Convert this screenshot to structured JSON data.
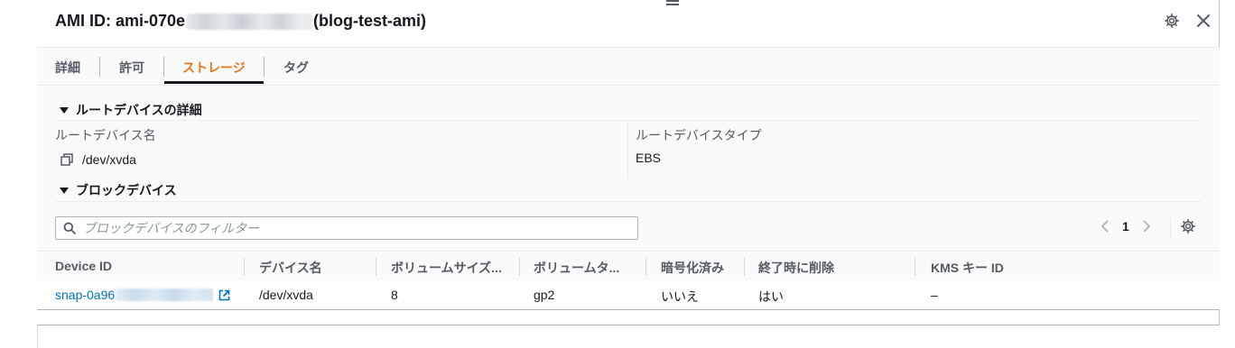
{
  "panel": {
    "title_prefix": "AMI ID: ami-070e",
    "title_suffix": "(blog-test-ami)"
  },
  "icons": {
    "settings": "gear-icon",
    "close": "close-icon",
    "copy": "copy-icon",
    "search": "search-icon",
    "external": "external-link-icon",
    "prev": "chevron-left-icon",
    "next": "chevron-right-icon"
  },
  "tabs": [
    {
      "label": "詳細",
      "active": false
    },
    {
      "label": "許可",
      "active": false
    },
    {
      "label": "ストレージ",
      "active": true
    },
    {
      "label": "タグ",
      "active": false
    }
  ],
  "root_device": {
    "section_title": "ルートデバイスの詳細",
    "name_label": "ルートデバイス名",
    "name_value": "/dev/xvda",
    "type_label": "ルートデバイスタイプ",
    "type_value": "EBS"
  },
  "block_devices": {
    "section_title": "ブロックデバイス",
    "filter_placeholder": "ブロックデバイスのフィルター",
    "page": "1",
    "columns": [
      "Device ID",
      "デバイス名",
      "ボリュームサイズ...",
      "ボリュームタ...",
      "暗号化済み",
      "終了時に削除",
      "KMS キー ID"
    ],
    "rows": [
      {
        "device_id_prefix": "snap-0a96",
        "device_name": "/dev/xvda",
        "volume_size": "8",
        "volume_type": "gp2",
        "encrypted": "いいえ",
        "delete_on_termination": "はい",
        "kms_key_id": "–"
      }
    ]
  },
  "colors": {
    "accent": "#ec7211",
    "link": "#0073bb",
    "text": "#16191f",
    "muted": "#545b64"
  }
}
